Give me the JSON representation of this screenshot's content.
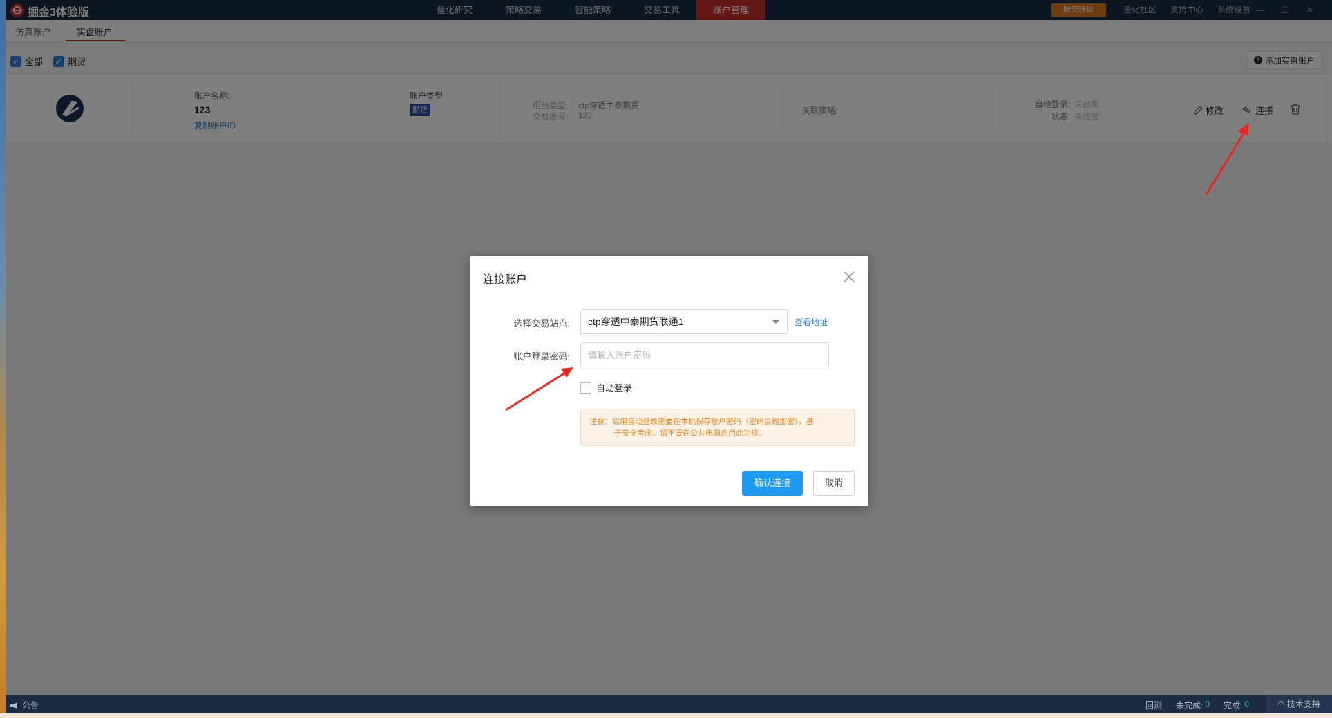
{
  "app": {
    "title": "掘金3体验版",
    "nav": [
      "量化研究",
      "策略交易",
      "智能策略",
      "交易工具",
      "账户管理"
    ],
    "upgrade": "服务升级",
    "top_links": [
      "量化社区",
      "支持中心",
      "系统设置"
    ]
  },
  "subtabs": [
    "仿真账户",
    "实盘账户"
  ],
  "filters": {
    "all": "全部",
    "futures": "期货",
    "add_button": "添加实盘账户"
  },
  "account": {
    "name_label": "账户名称:",
    "name": "123",
    "copy_id": "复制账户ID",
    "type_label": "账户类型",
    "type_tag": "期货",
    "counter_label": "柜台类型:",
    "counter_value": "ctp穿透中泰期货",
    "trade_label": "交易帐号:",
    "trade_value": "123",
    "strategy_label": "关联策略:",
    "autologin_label": "自动登录:",
    "autologin_value": "未启用",
    "status_label": "状态:",
    "status_value": "未连接",
    "edit": "修改",
    "connect": "连接"
  },
  "dialog": {
    "title": "连接账户",
    "station_label": "选择交易站点:",
    "station_value": "ctp穿透中泰期货联通1",
    "view_address": "查看地址",
    "password_label": "账户登录密码:",
    "password_placeholder": "请输入账户密码",
    "auto_login": "自动登录",
    "notice_line1": "注意：启用自动登录需要在本机保存账户密码（密码会被加密），基",
    "notice_line2": "于安全考虑，请不要在公共电脑启用此功能。",
    "confirm": "确认连接",
    "cancel": "取消"
  },
  "statusbar": {
    "notice": "公告",
    "backtest": "回测",
    "pending_label": "未完成:",
    "pending_value": "0",
    "done_label": "完成:",
    "done_value": "0",
    "support": "技术支持"
  },
  "colors": {
    "titlebar": "#1c2b44",
    "active_nav": "#c9302c",
    "primary_button": "#1e9bf0",
    "annotation_arrow": "#e8281e"
  }
}
